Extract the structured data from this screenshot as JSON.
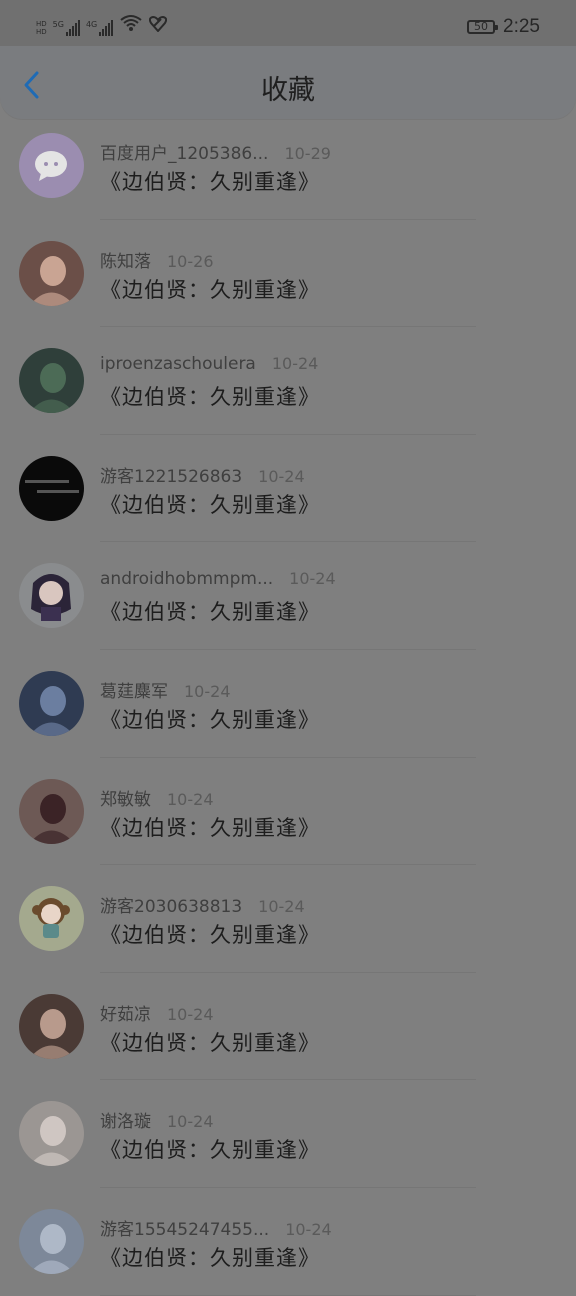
{
  "status_bar": {
    "network_left": "HD",
    "network_1": "5G",
    "network_2": "4G",
    "wifi_label": "6",
    "battery": "50",
    "time": "2:25"
  },
  "header": {
    "title": "收藏",
    "back_icon": "chevron-left-icon"
  },
  "items": [
    {
      "user": "百度用户_1205386...",
      "date": "10-29",
      "content": "《边伯贤：久别重逢》"
    },
    {
      "user": "陈知落",
      "date": "10-26",
      "content": "《边伯贤：久别重逢》"
    },
    {
      "user": "iproenzaschoulera",
      "date": "10-24",
      "content": "《边伯贤：久别重逢》"
    },
    {
      "user": "游客1221526863",
      "date": "10-24",
      "content": "《边伯贤：久别重逢》"
    },
    {
      "user": "androidhobmmpm...",
      "date": "10-24",
      "content": "《边伯贤：久别重逢》"
    },
    {
      "user": "葛莛麋军",
      "date": "10-24",
      "content": "《边伯贤：久别重逢》"
    },
    {
      "user": "郑敏敏",
      "date": "10-24",
      "content": "《边伯贤：久别重逢》"
    },
    {
      "user": "游客2030638813",
      "date": "10-24",
      "content": "《边伯贤：久别重逢》"
    },
    {
      "user": "好茹凉",
      "date": "10-24",
      "content": "《边伯贤：久别重逢》"
    },
    {
      "user": "谢洛璇",
      "date": "10-24",
      "content": "《边伯贤：久别重逢》"
    },
    {
      "user": "游客15545247455...",
      "date": "10-24",
      "content": "《边伯贤：久别重逢》"
    }
  ]
}
